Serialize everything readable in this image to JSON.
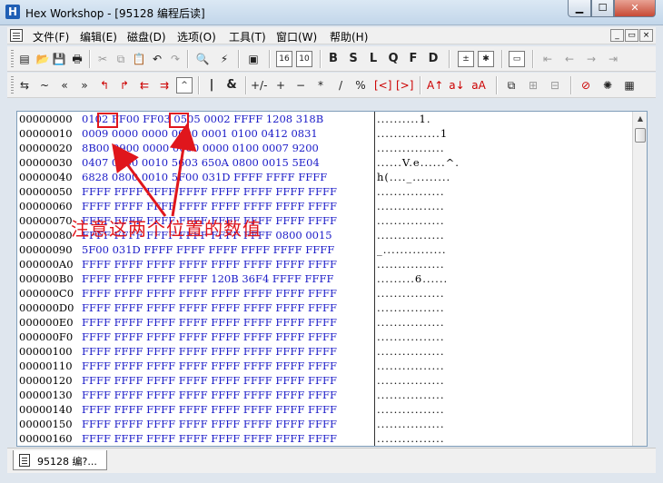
{
  "window": {
    "icon": "H",
    "title": "Hex Workshop - [95128 编程后读]",
    "buttons": {
      "minimize": "▁",
      "maximize": "☐",
      "close": "✕"
    }
  },
  "menu": {
    "items": [
      "文件(F)",
      "编辑(E)",
      "磁盘(D)",
      "选项(O)",
      "工具(T)",
      "窗口(W)",
      "帮助(H)"
    ],
    "mdi_buttons": [
      "_",
      "▭",
      "×"
    ]
  },
  "toolbar1": {
    "icons": [
      "open-icon",
      "open-folder-icon",
      "save-icon",
      "print-icon",
      "cut-icon",
      "copy-icon",
      "paste-icon",
      "undo-icon",
      "redo-icon",
      "find-icon",
      "find-replace-icon",
      "goto-icon",
      "base16-icon",
      "base10-icon",
      "byte-icon",
      "short-icon",
      "long-icon",
      "quad-icon",
      "float-icon",
      "double-icon",
      "calculator-icon",
      "bookmark-icon",
      "properties-icon",
      "first-icon",
      "prev-icon",
      "next-icon",
      "last-icon"
    ],
    "glyphs": {
      "base16": "16",
      "base10": "10",
      "byte": "B",
      "short": "S",
      "long": "L",
      "quad": "Q",
      "float": "F",
      "double": "D"
    }
  },
  "toolbar2": {
    "glyphs": [
      "⇆",
      "~",
      "«",
      "»",
      "↰",
      "↱",
      "⇇",
      "⇉",
      "^",
      "|",
      "&",
      "+/-",
      "+",
      "−",
      "*",
      "/",
      "%",
      "[<]",
      "[>]",
      "A↑",
      "a↓",
      "aA"
    ]
  },
  "editor": {
    "addresses": [
      "00000000",
      "00000010",
      "00000020",
      "00000030",
      "00000040",
      "00000050",
      "00000060",
      "00000070",
      "00000080",
      "00000090",
      "000000A0",
      "000000B0",
      "000000C0",
      "000000D0",
      "000000E0",
      "000000F0",
      "00000100",
      "00000110",
      "00000120",
      "00000130",
      "00000140",
      "00000150",
      "00000160"
    ],
    "hex_rows": [
      "0102 FF00 FF03 0505 0002 FFFF 1208 318B",
      "0009 0000 0000 0000 0001 0100 0412 0831",
      "8B00 0900 0000 0000 0000 0100 0007 9200",
      "0407 0000 0010 5603 650A 0800 0015 5E04",
      "6828 0800 0010 5F00 031D FFFF FFFF FFFF",
      "FFFF FFFF FFFF FFFF FFFF FFFF FFFF FFFF",
      "FFFF FFFF FFFF FFFF FFFF FFFF FFFF FFFF",
      "FFFF FFFF FFFF FFFF FFFF FFFF FFFF FFFF",
      "FFFF FFFF FFFF FFFF FFFF FFFF 0800 0015",
      "5F00 031D FFFF FFFF FFFF FFFF FFFF FFFF",
      "FFFF FFFF FFFF FFFF FFFF FFFF FFFF FFFF",
      "FFFF FFFF FFFF FFFF 120B 36F4 FFFF FFFF",
      "FFFF FFFF FFFF FFFF FFFF FFFF FFFF FFFF",
      "FFFF FFFF FFFF FFFF FFFF FFFF FFFF FFFF",
      "FFFF FFFF FFFF FFFF FFFF FFFF FFFF FFFF",
      "FFFF FFFF FFFF FFFF FFFF FFFF FFFF FFFF",
      "FFFF FFFF FFFF FFFF FFFF FFFF FFFF FFFF",
      "FFFF FFFF FFFF FFFF FFFF FFFF FFFF FFFF",
      "FFFF FFFF FFFF FFFF FFFF FFFF FFFF FFFF",
      "FFFF FFFF FFFF FFFF FFFF FFFF FFFF FFFF",
      "FFFF FFFF FFFF FFFF FFFF FFFF FFFF FFFF",
      "FFFF FFFF FFFF FFFF FFFF FFFF FFFF FFFF",
      "FFFF FFFF FFFF FFFF FFFF FFFF FFFF FFFF"
    ],
    "ascii_rows": [
      "..........1.",
      "...............1",
      "................",
      "......V.e......^.",
      "h(...._.........",
      "................",
      "................",
      "................",
      "................",
      "_...............",
      "................",
      ".........6......",
      "................",
      "................",
      "................",
      "................",
      "................",
      "................",
      "................",
      "................",
      "................",
      "................",
      "................"
    ]
  },
  "annotation": {
    "text": "注意这两个位置的数值",
    "color": "#e0161c"
  },
  "tabs": [
    {
      "label": "95128 编?..."
    }
  ]
}
